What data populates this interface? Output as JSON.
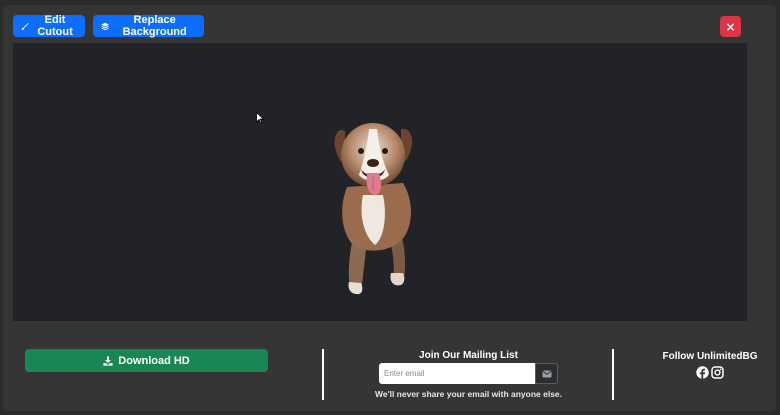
{
  "toolbar": {
    "edit_cutout_label": "Edit Cutout",
    "replace_background_label": "Replace Background",
    "close_label": "×"
  },
  "actions": {
    "download_label": "Download HD"
  },
  "mailing": {
    "title": "Join Our Mailing List",
    "placeholder": "Enter email",
    "note": "We'll never share your email with anyone else."
  },
  "social": {
    "title": "Follow UnlimitedBG",
    "icons": [
      "facebook-icon",
      "instagram-icon"
    ]
  },
  "colors": {
    "primary": "#0d6efd",
    "success": "#198754",
    "danger": "#dc3545",
    "canvas_bg": "#212326"
  }
}
